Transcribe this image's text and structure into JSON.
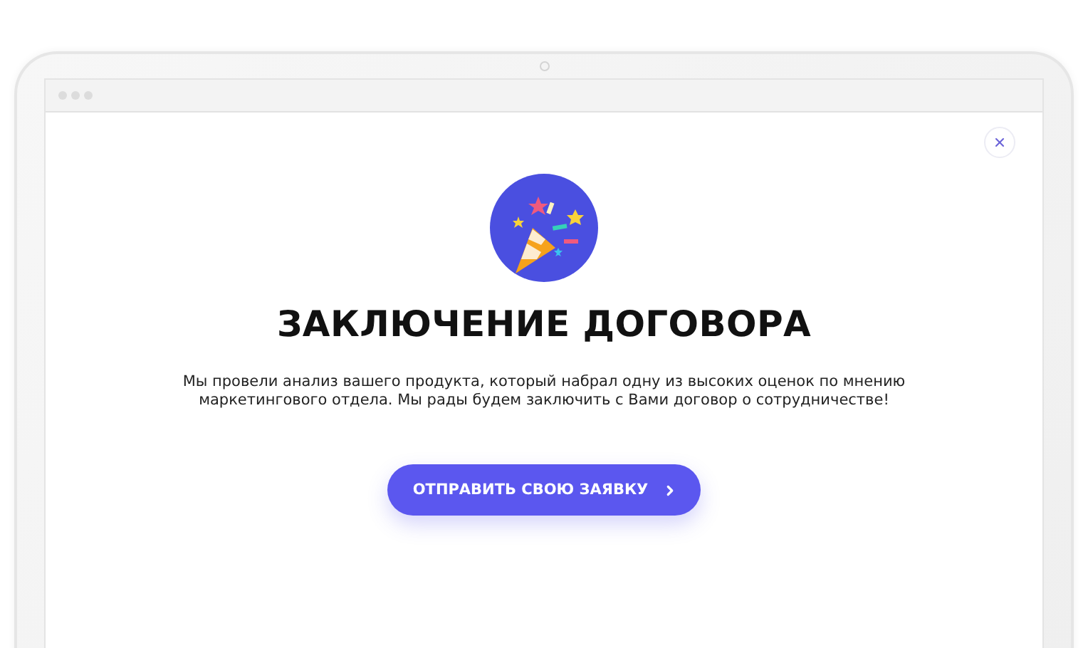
{
  "dialog": {
    "title": "ЗАКЛЮЧЕНИЕ ДОГОВОРА",
    "text": "Мы провели анализ вашего продукта, который набрал одну из высоких оценок по мнению маркетингового отдела. Мы рады будем заключить с Вами договор о сотрудничестве!",
    "button": "ОТПРАВИТЬ СВОЮ ЗАЯВКУ"
  }
}
